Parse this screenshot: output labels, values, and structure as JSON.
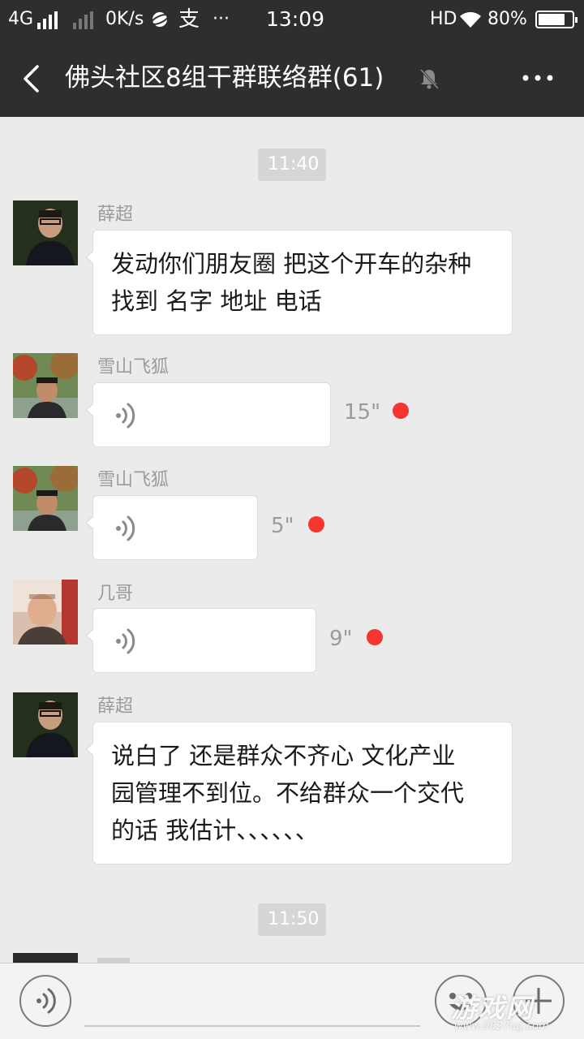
{
  "status_bar": {
    "network": "4G",
    "speed": "0K/s",
    "app_glyph": "支",
    "more": "···",
    "time": "13:09",
    "hd": "HD",
    "battery": "80%",
    "battery_level": 0.8
  },
  "header": {
    "title": "佛头社区8组干群联络群(61)",
    "back_icon": "chevron-left-icon",
    "mute_icon": "bell-off-icon",
    "more_icon": "ellipsis-icon"
  },
  "chat": {
    "time_1": "11:40",
    "time_2": "11:50",
    "messages": [
      {
        "sender": "薛超",
        "lines": [
          "发动你们朋友圈 把这个开车的杂种",
          "找到 名字 地址 电话"
        ]
      },
      {
        "sender": "雪山飞狐",
        "duration": "15\""
      },
      {
        "sender": "雪山飞狐",
        "duration": "5\""
      },
      {
        "sender": "几哥",
        "duration": "9\""
      },
      {
        "sender": "薛超",
        "lines": [
          "说白了 还是群众不齐心  文化产业",
          "园管理不到位。不给群众一个交代",
          "的话 我估计、、、、、、"
        ]
      }
    ]
  },
  "input_bar": {
    "voice_icon": "voice-toggle-icon",
    "emoji_icon": "smiley-icon",
    "plus_icon": "plus-icon",
    "watermark": "游戏网",
    "watermark_sub": "www.0827ug.com"
  },
  "colors": {
    "header_bg": "#2e2e2e",
    "chat_bg": "#ebebeb",
    "unread": "#f43530"
  }
}
